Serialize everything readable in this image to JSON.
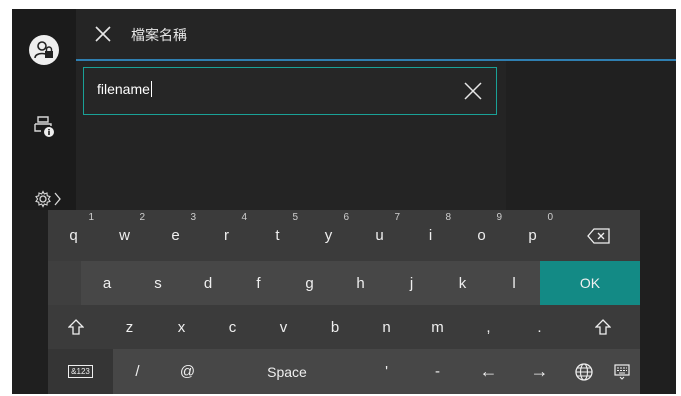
{
  "app": {
    "title": "檔案名稱"
  },
  "sidebar": {
    "items": [
      {
        "icon": "user-lock-icon"
      },
      {
        "icon": "printer-info-icon"
      },
      {
        "icon": "settings-gear-icon"
      }
    ]
  },
  "input": {
    "value": "filename"
  },
  "keyboard": {
    "row1": [
      {
        "label": "q",
        "hint": "1"
      },
      {
        "label": "w",
        "hint": "2"
      },
      {
        "label": "e",
        "hint": "3"
      },
      {
        "label": "r",
        "hint": "4"
      },
      {
        "label": "t",
        "hint": "5"
      },
      {
        "label": "y",
        "hint": "6"
      },
      {
        "label": "u",
        "hint": "7"
      },
      {
        "label": "i",
        "hint": "8"
      },
      {
        "label": "o",
        "hint": "9"
      },
      {
        "label": "p",
        "hint": "0"
      }
    ],
    "row2": [
      "a",
      "s",
      "d",
      "f",
      "g",
      "h",
      "j",
      "k",
      "l"
    ],
    "ok_label": "OK",
    "row3": [
      "z",
      "x",
      "c",
      "v",
      "b",
      "n",
      "m",
      ",",
      "."
    ],
    "row4": {
      "symbols_label": "&123",
      "slash": "/",
      "at": "@",
      "space_label": "Space",
      "apostrophe": "'",
      "dash": "-",
      "left_arrow": "←",
      "right_arrow": "→"
    }
  },
  "colors": {
    "accent": "#138a85",
    "header_line": "#2f7fb1",
    "input_border": "#1aa197"
  }
}
